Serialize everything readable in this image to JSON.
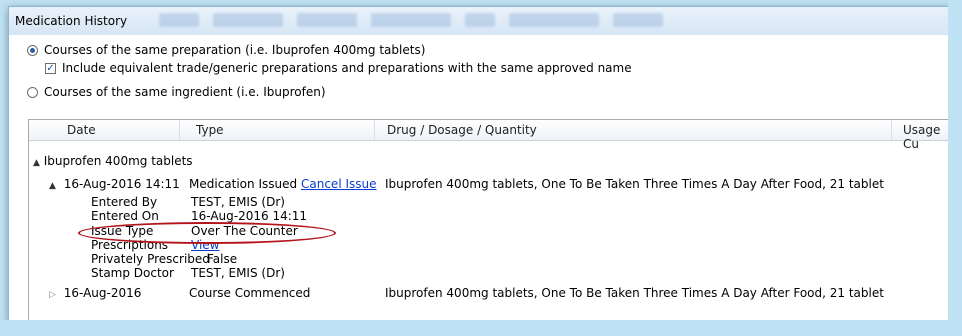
{
  "window": {
    "title": "Medication History"
  },
  "options": {
    "same_preparation": "Courses of the same preparation (i.e. Ibuprofen 400mg tablets)",
    "include_equivalent": "Include equivalent trade/generic preparations and preparations with the same approved name",
    "same_ingredient": "Courses of the same ingredient (i.e. Ibuprofen)"
  },
  "grid": {
    "headers": {
      "date": "Date",
      "type": "Type",
      "drug": "Drug / Dosage / Quantity",
      "usage": "Usage Cu"
    },
    "group_label": "Ibuprofen 400mg tablets",
    "issue": {
      "date": "16-Aug-2016 14:11",
      "type": "Medication Issued",
      "action": "Cancel Issue",
      "drug": "Ibuprofen 400mg tablets, One To Be Taken Three Times A Day After Food, 21 tablet"
    },
    "details": [
      {
        "label": "Entered By",
        "value": "TEST, EMIS (Dr)"
      },
      {
        "label": "Entered On",
        "value": "16-Aug-2016 14:11"
      },
      {
        "label": "Issue Type",
        "value": "Over The Counter"
      },
      {
        "label": "Prescriptions",
        "value": "View"
      },
      {
        "label": "Privately Prescribed",
        "value": "False"
      },
      {
        "label": "Stamp Doctor",
        "value": "TEST, EMIS (Dr)"
      }
    ],
    "course": {
      "date": "16-Aug-2016",
      "type": "Course Commenced",
      "drug": "Ibuprofen 400mg tablets, One To Be Taken Three Times A Day After Food, 21 tablet"
    }
  },
  "icons": {
    "expanded": "▲",
    "collapsed": "▷",
    "check": "✓"
  },
  "colors": {
    "link": "#0a3ccf",
    "highlight": "#b3141b"
  }
}
